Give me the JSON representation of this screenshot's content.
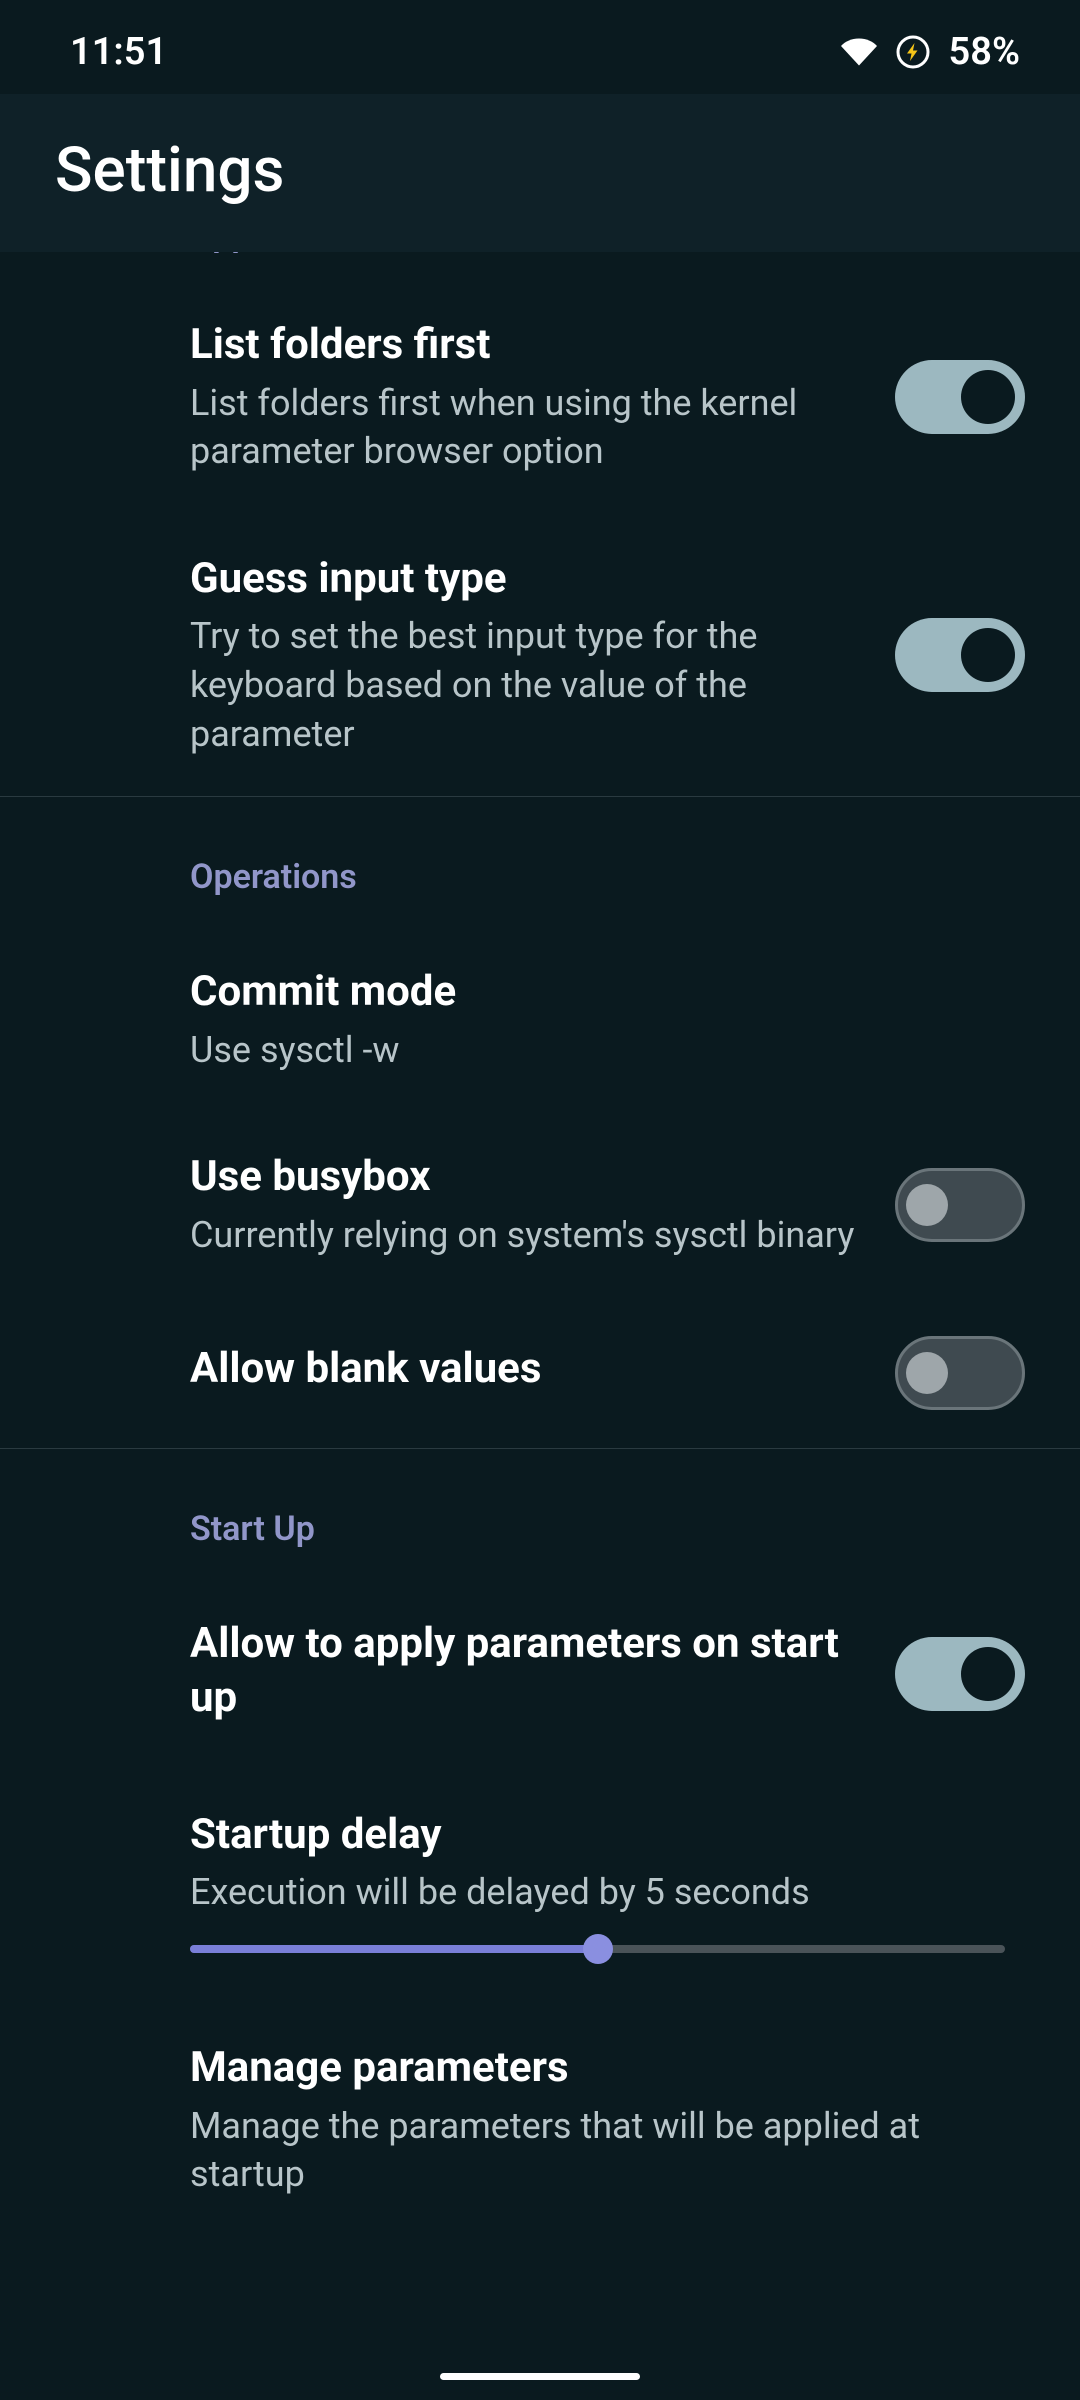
{
  "status": {
    "time": "11:51",
    "battery": "58%"
  },
  "header": {
    "title": "Settings"
  },
  "sections": {
    "application": {
      "header": "Application",
      "list_folders": {
        "title": "List folders first",
        "desc": "List folders first when using the kernel parameter browser option",
        "on": true
      },
      "guess_input": {
        "title": "Guess input type",
        "desc": "Try to set the best input type for the keyboard based on the value of the parameter",
        "on": true
      }
    },
    "operations": {
      "header": "Operations",
      "commit_mode": {
        "title": "Commit mode",
        "desc": "Use sysctl -w"
      },
      "use_busybox": {
        "title": "Use busybox",
        "desc": "Currently relying on system's sysctl binary",
        "on": false
      },
      "allow_blank": {
        "title": "Allow blank values",
        "on": false
      }
    },
    "startup": {
      "header": "Start Up",
      "allow_apply": {
        "title": "Allow to apply parameters on start up",
        "on": true
      },
      "startup_delay": {
        "title": "Startup delay",
        "desc": "Execution will be delayed by 5 seconds",
        "value": 5,
        "min": 0,
        "max": 10,
        "percent": 50
      },
      "manage_params": {
        "title": "Manage parameters",
        "desc": "Manage the parameters that will be applied at startup"
      }
    }
  }
}
